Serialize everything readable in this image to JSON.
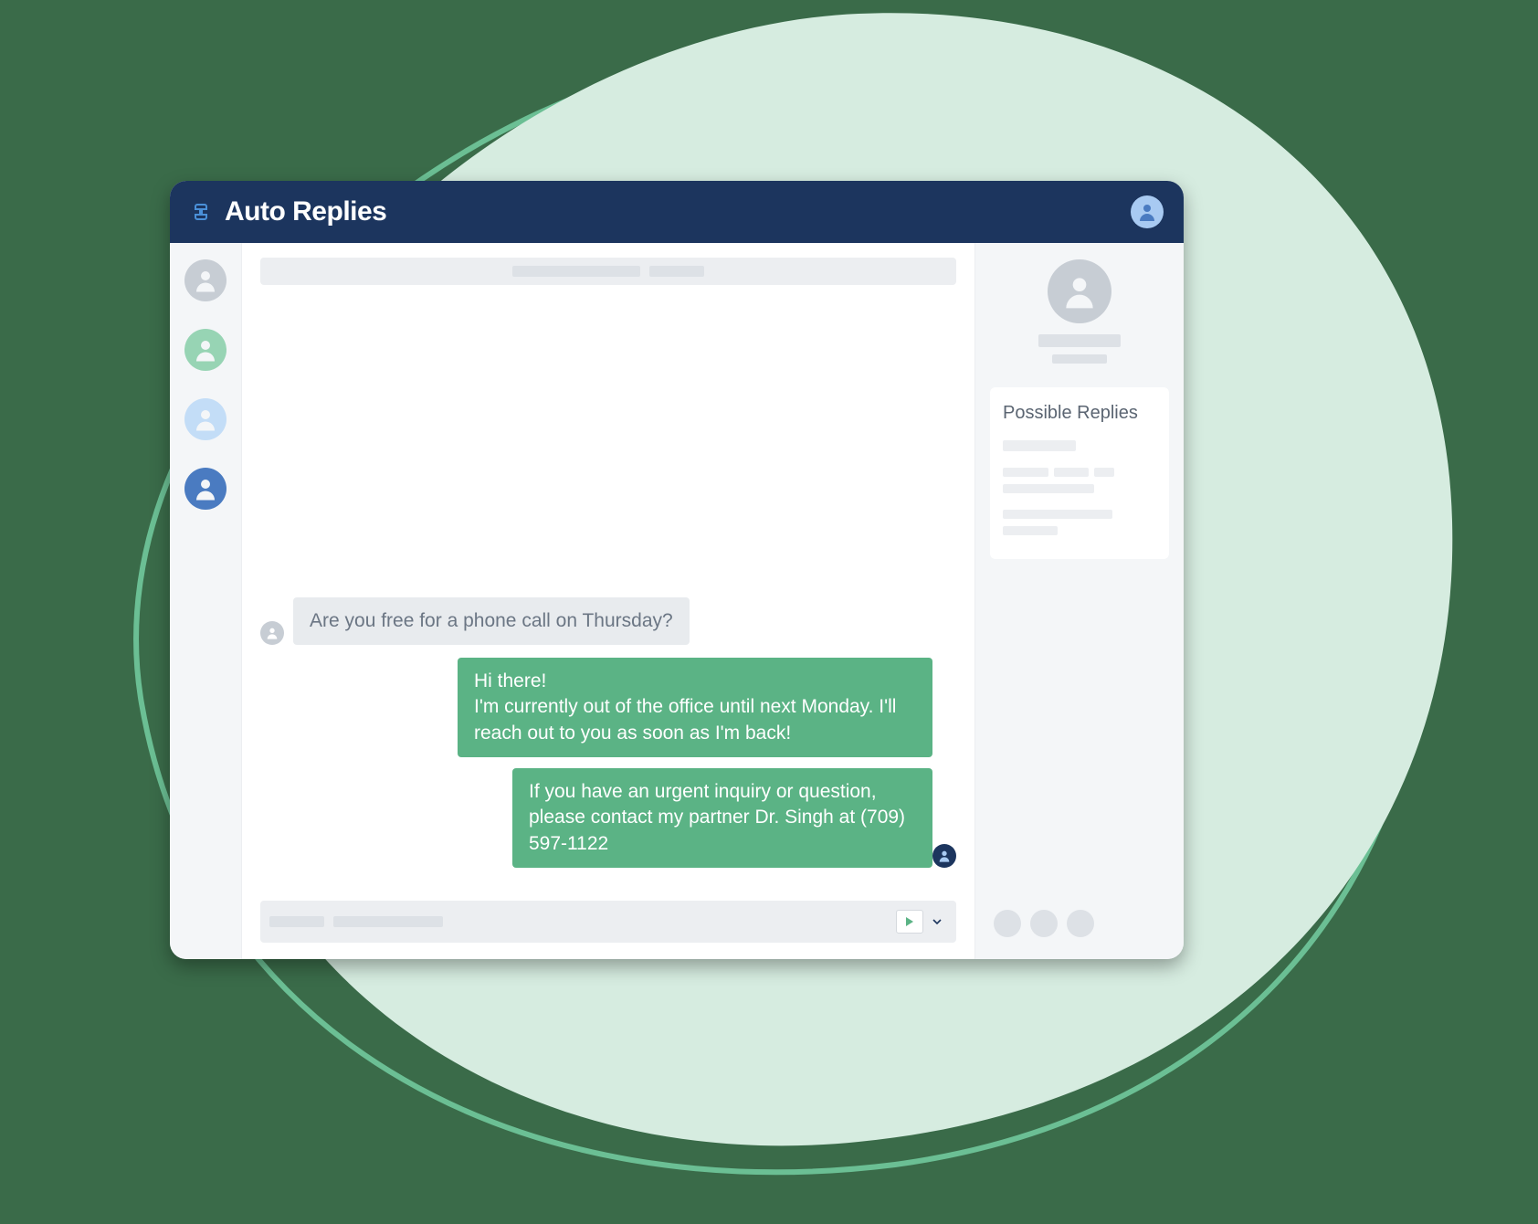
{
  "header": {
    "title": "Auto Replies"
  },
  "chat": {
    "incoming_message": "Are you free for a phone call on Thursday?",
    "outgoing_message_1": "Hi there!\nI'm currently out of the office until next Monday. I'll reach out to you as soon as I'm back!",
    "outgoing_message_2": "If you have an urgent inquiry or question, please contact my partner Dr. Singh at (709) 597-1122"
  },
  "right_panel": {
    "possible_replies_title": "Possible Replies"
  },
  "colors": {
    "header_bg": "#1c355e",
    "accent_green": "#5bb385",
    "page_bg": "#3a6b49",
    "blob_fill": "#d6ece0",
    "blob_stroke": "#6bbf94"
  }
}
